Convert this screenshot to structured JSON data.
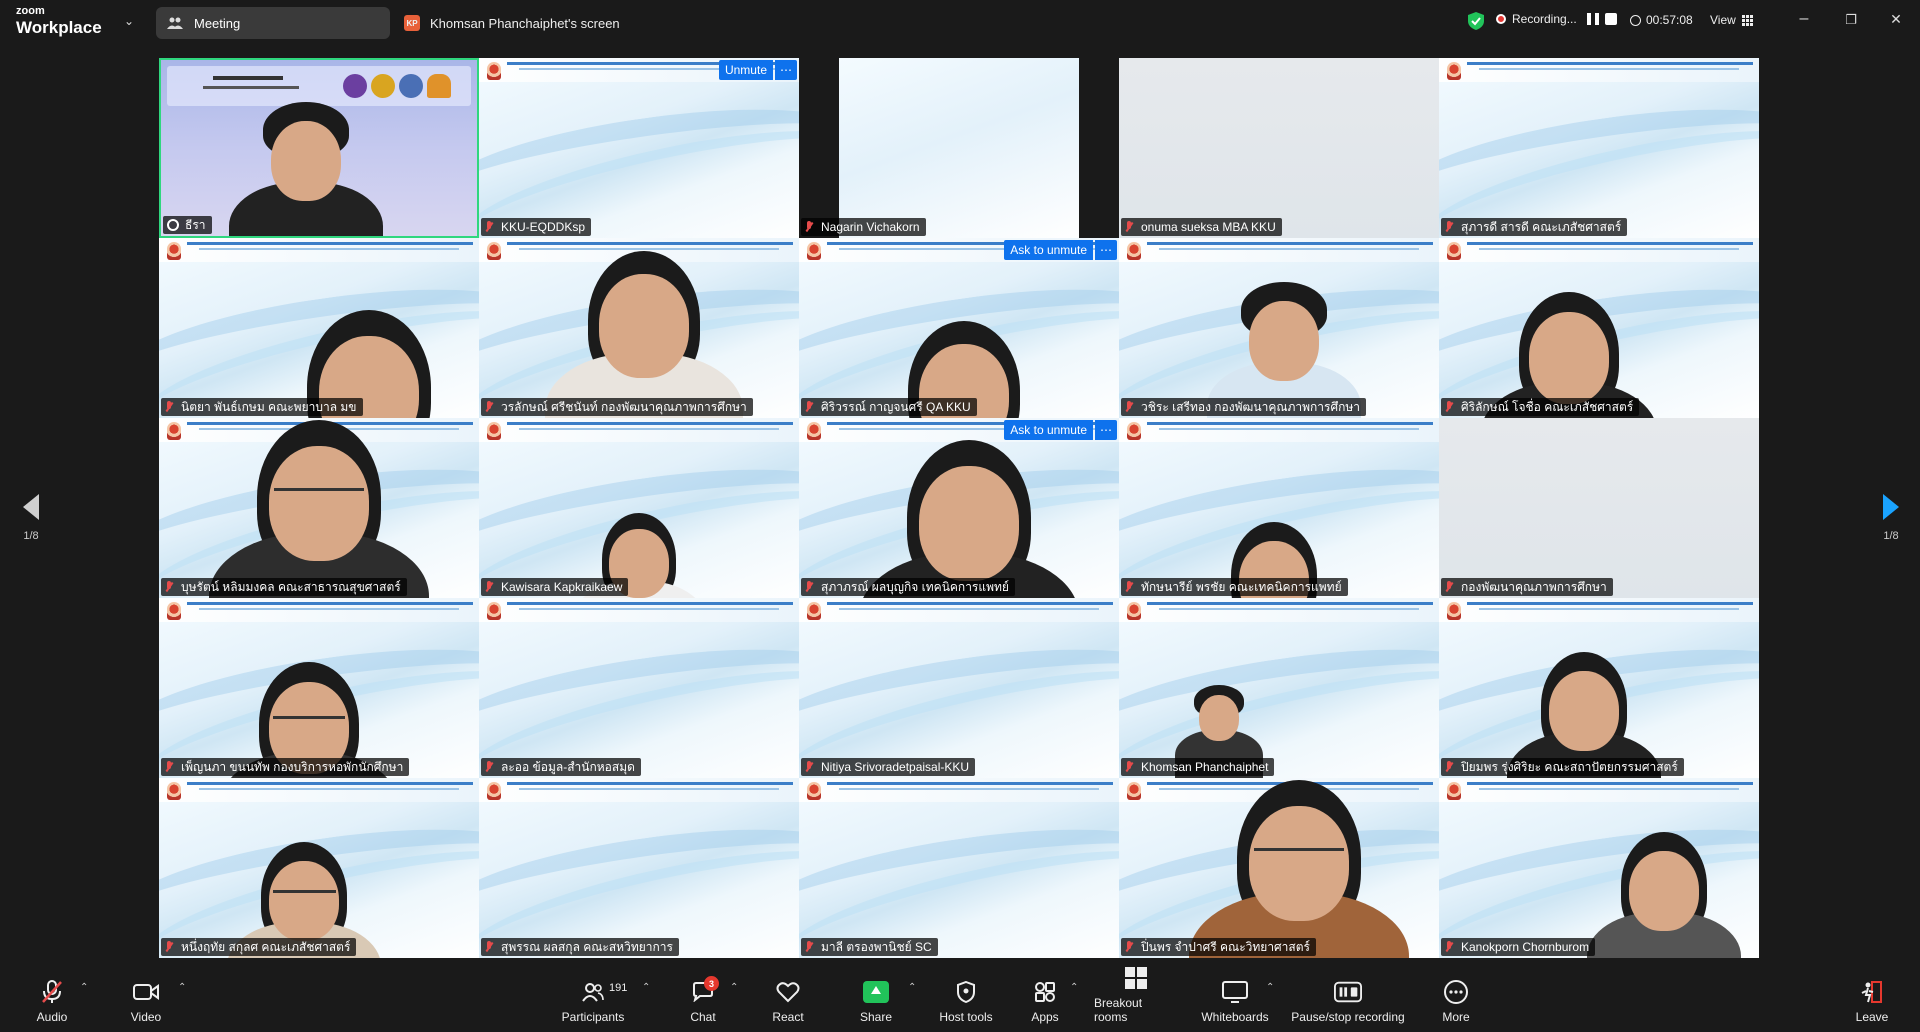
{
  "window": {
    "brand_line1": "zoom",
    "brand_line2": "Workplace",
    "tab_meeting": "Meeting",
    "screen_badge": "KP",
    "tab_screen": "Khomsan Phanchaiphet's screen",
    "recording_label": "Recording...",
    "timer": "00:57:08",
    "view_label": "View",
    "minimize": "–",
    "restore": "❐",
    "close": "✕"
  },
  "pager": {
    "left": "1/8",
    "right": "1/8"
  },
  "tiles": [
    {
      "name": "ธีรา",
      "host": true
    },
    {
      "name": "KKU-EQDDKsp",
      "overlay": "Unmute"
    },
    {
      "name": "Nagarin Vichakorn",
      "style": "black"
    },
    {
      "name": "onuma sueksa MBA KKU",
      "style": "gray"
    },
    {
      "name": "สุภารดี สารดี คณะเภสัชศาสตร์"
    },
    {
      "name": "นิตยา พันธ์เกษม คณะพยาบาล มข"
    },
    {
      "name": "วรลักษณ์ ศรีชนันท์ กองพัฒนาคุณภาพการศึกษา"
    },
    {
      "name": "ศิริวรรณ์ กาญจนศรี QA KKU",
      "overlay": "Ask to unmute"
    },
    {
      "name": "วชิระ เสรีทอง กองพัฒนาคุณภาพการศึกษา"
    },
    {
      "name": "ศิริลักษณ์ โจชื่อ คณะเภสัชศาสตร์"
    },
    {
      "name": "บุษรัตน์ หลิมมงคล คณะสาธารณสุขศาสตร์"
    },
    {
      "name": "Kawisara Kapkraikaew"
    },
    {
      "name": "สุภาภรณ์ ผลบุญกิจ เทคนิคการแพทย์",
      "overlay": "Ask to unmute"
    },
    {
      "name": "ทักษนารีย์ พรชัย คณะเทคนิคการแพทย์"
    },
    {
      "name": "กองพัฒนาคุณภาพการศึกษา",
      "style": "gray"
    },
    {
      "name": "เพ็ญนภา ขนนทัพ กองบริการหอพักนักศึกษา"
    },
    {
      "name": "ละออ ข้อมูล-สำนักหอสมุด"
    },
    {
      "name": "Nitiya Srivoradetpaisal-KKU"
    },
    {
      "name": "Khomsan Phanchaiphet"
    },
    {
      "name": "ปิยมพร รุ่งศิริยะ คณะสถาปัตยกรรมศาสตร์"
    },
    {
      "name": "หนึ่งฤทัย สกุลศ คณะเภสัชศาสตร์"
    },
    {
      "name": "สุพรรณ ผลสกุล คณะสหวิทยาการ"
    },
    {
      "name": "มาลี ตรองพานิชย์ SC"
    },
    {
      "name": "ปิ่นพร จำปาศรี คณะวิทยาศาสตร์"
    },
    {
      "name": "Kanokporn Chornburom"
    }
  ],
  "toolbar": {
    "audio": "Audio",
    "video": "Video",
    "participants": "Participants",
    "participants_count": "191",
    "chat": "Chat",
    "chat_badge": "3",
    "react": "React",
    "share": "Share",
    "host_tools": "Host tools",
    "apps": "Apps",
    "breakout_rooms": "Breakout rooms",
    "whiteboards": "Whiteboards",
    "pause_stop_recording": "Pause/stop recording",
    "more": "More",
    "leave": "Leave"
  },
  "colors": {
    "accent_blue": "#0e72ed",
    "share_green": "#21c35a",
    "active_speaker": "#2fd77e",
    "muted_red": "#e54b4b",
    "leave_red": "#e5382e"
  }
}
